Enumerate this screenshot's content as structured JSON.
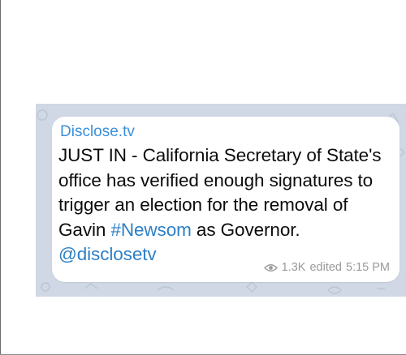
{
  "post": {
    "sender": "Disclose.tv",
    "text_parts": {
      "p1": "JUST IN - California Secretary of State's office has verified enough signatures to trigger an election for the removal of Gavin ",
      "hashtag": "#Newsom",
      "p2": " as Governor. ",
      "mention": "@disclosetv"
    },
    "views": "1.3K",
    "status": "edited",
    "time": "5:15 PM",
    "view_icon": "eye-icon"
  },
  "colors": {
    "sender": "#3a8fd9",
    "link": "#2d7fc6",
    "chat_background": "#cfd8e4",
    "meta_text": "#9a9a9a"
  }
}
